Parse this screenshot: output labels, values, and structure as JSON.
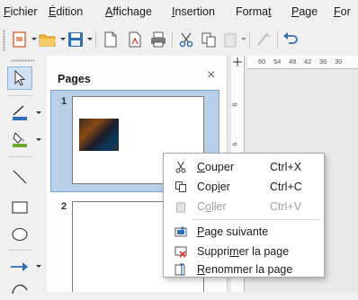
{
  "menubar": {
    "items": [
      {
        "pre": "",
        "u": "F",
        "post": "ichier"
      },
      {
        "pre": "",
        "u": "É",
        "post": "dition"
      },
      {
        "pre": "",
        "u": "A",
        "post": "ffichage"
      },
      {
        "pre": "",
        "u": "I",
        "post": "nsertion"
      },
      {
        "pre": "Forma",
        "u": "t",
        "post": ""
      },
      {
        "pre": "",
        "u": "P",
        "post": "age"
      },
      {
        "pre": "",
        "u": "F",
        "post": "or"
      }
    ]
  },
  "pages_panel": {
    "title": "Pages",
    "close": "×",
    "slides": [
      {
        "number": "1"
      },
      {
        "number": "2"
      }
    ]
  },
  "ruler": {
    "h_ticks": [
      "60",
      "54",
      "48",
      "42",
      "36",
      "30"
    ],
    "v_ticks": [
      "6",
      "6"
    ]
  },
  "context_menu": {
    "items": [
      {
        "pre": "",
        "u": "C",
        "post": "ouper",
        "shortcut": "Ctrl+X",
        "icon": "scissors-icon",
        "enabled": true
      },
      {
        "pre": "Cop",
        "u": "i",
        "post": "er",
        "shortcut": "Ctrl+C",
        "icon": "copy-icon",
        "enabled": true
      },
      {
        "pre": "C",
        "u": "o",
        "post": "ller",
        "shortcut": "Ctrl+V",
        "icon": "paste-icon",
        "enabled": false
      },
      {
        "pre": "",
        "u": "P",
        "post": "age suivante",
        "shortcut": "",
        "icon": "new-page-icon",
        "enabled": true
      },
      {
        "pre": "Suppri",
        "u": "m",
        "post": "er la page",
        "shortcut": "",
        "icon": "delete-page-icon",
        "enabled": true
      },
      {
        "pre": "",
        "u": "R",
        "post": "enommer la page",
        "shortcut": "",
        "icon": "rename-page-icon",
        "enabled": true
      }
    ]
  },
  "colors": {
    "selection": "#b7cfe8",
    "accent_blue": "#2f6fb5",
    "delete_red": "#d9342b"
  }
}
